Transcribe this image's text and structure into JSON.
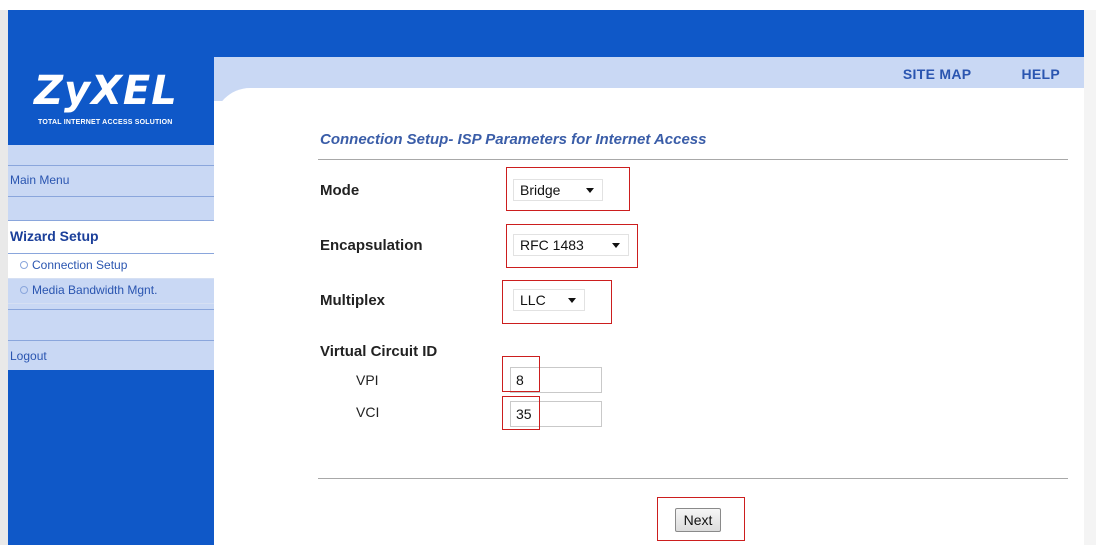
{
  "brand": {
    "name": "ZyXEL",
    "tagline": "TOTAL INTERNET ACCESS SOLUTION"
  },
  "header": {
    "links": [
      "SITE MAP",
      "HELP"
    ]
  },
  "sidebar": {
    "main_menu": "Main Menu",
    "wizard_setup": "Wizard Setup",
    "items": [
      {
        "label": "Connection Setup",
        "selected": true
      },
      {
        "label": "Media Bandwidth Mgnt.",
        "selected": false
      }
    ],
    "logout": "Logout"
  },
  "page": {
    "title": "Connection Setup- ISP Parameters for Internet Access",
    "mode": {
      "label": "Mode",
      "value": "Bridge"
    },
    "encapsulation": {
      "label": "Encapsulation",
      "value": "RFC 1483"
    },
    "multiplex": {
      "label": "Multiplex",
      "value": "LLC"
    },
    "vc_id": {
      "label": "Virtual Circuit ID",
      "vpi": {
        "label": "VPI",
        "value": "8"
      },
      "vci": {
        "label": "VCI",
        "value": "35"
      }
    },
    "next_label": "Next"
  },
  "colors": {
    "brand_blue": "#0f58c8",
    "light_band": "#c9d8f4",
    "link_blue": "#2a55b0",
    "highlight_red": "#cc1e1e"
  }
}
